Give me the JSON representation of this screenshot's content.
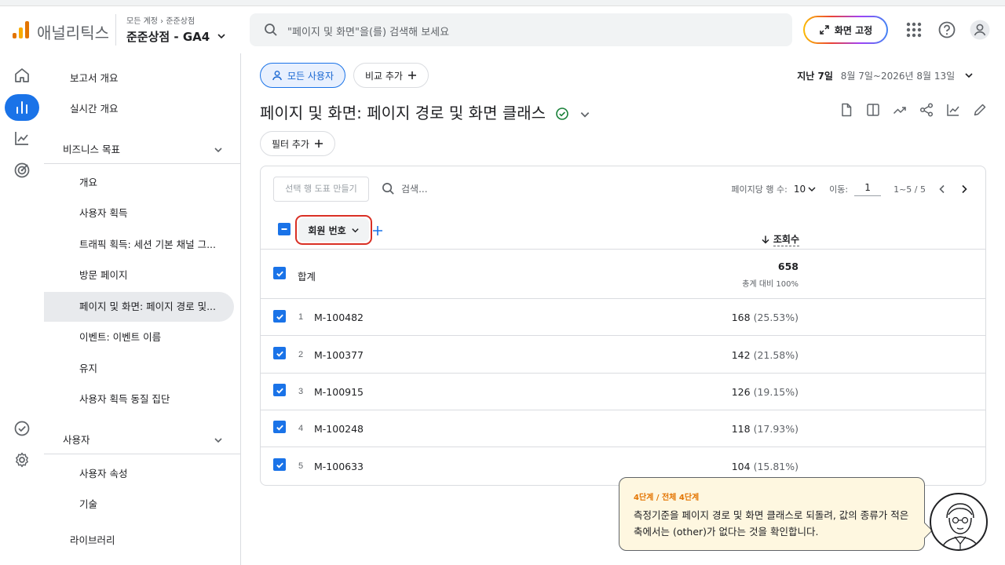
{
  "header": {
    "brand": "애널리틱스",
    "crumb_account": "모든 계정",
    "crumb_sep": "›",
    "crumb_store": "준준상점",
    "property": "준준상점 - GA4",
    "search_placeholder": "\"페이지 및 화면\"을(를) 검색해 보세요",
    "pin_label": "화면 고정"
  },
  "nav": {
    "report_overview": "보고서 개요",
    "realtime": "실시간 개요",
    "business_section": "비즈니스 목표",
    "business_items": [
      "개요",
      "사용자 획득",
      "트래픽 획득: 세션 기본 채널 그...",
      "방문 페이지",
      "페이지 및 화면: 페이지 경로 및...",
      "이벤트: 이벤트 이름",
      "유지",
      "사용자 획득 동질 집단"
    ],
    "user_section": "사용자",
    "user_items": [
      "사용자 속성",
      "기술"
    ],
    "library": "라이브러리"
  },
  "main": {
    "segment_chip": "모든 사용자",
    "compare_chip": "비교 추가",
    "date_label": "지난 7일",
    "date_range": "8월 7일~2026년 8월 13일",
    "title": "페이지 및 화면: 페이지 경로 및 화면 클래스",
    "filter_chip": "필터 추가"
  },
  "table": {
    "make_chart": "선택 행 도표 만들기",
    "search_placeholder": "검색...",
    "rows_per_page_label": "페이지당 행 수:",
    "rows_per_page": "10",
    "goto_label": "이동:",
    "goto_value": "1",
    "range": "1~5 / 5",
    "dimension": "회원 번호",
    "metric": "조회수",
    "total_label": "합계",
    "total_value": "658",
    "total_sub": "총계 대비 100%",
    "rows": [
      {
        "idx": "1",
        "name": "M-100482",
        "value": "168",
        "pct": "(25.53%)"
      },
      {
        "idx": "2",
        "name": "M-100377",
        "value": "142",
        "pct": "(21.58%)"
      },
      {
        "idx": "3",
        "name": "M-100915",
        "value": "126",
        "pct": "(19.15%)"
      },
      {
        "idx": "4",
        "name": "M-100248",
        "value": "118",
        "pct": "(17.93%)"
      },
      {
        "idx": "5",
        "name": "M-100633",
        "value": "104",
        "pct": "(15.81%)"
      }
    ]
  },
  "tooltip": {
    "step": "4단계 / 전체 4단계",
    "message": "측정기준을 페이지 경로 및 화면 클래스로 되돌려, 값의 종류가 적은 축에서는 (other)가 없다는 것을 확인합니다."
  },
  "colors": {
    "accent": "#1a73e8",
    "highlight": "#d93025",
    "tip_bg": "#fef7e0",
    "step_text": "#e37400"
  }
}
